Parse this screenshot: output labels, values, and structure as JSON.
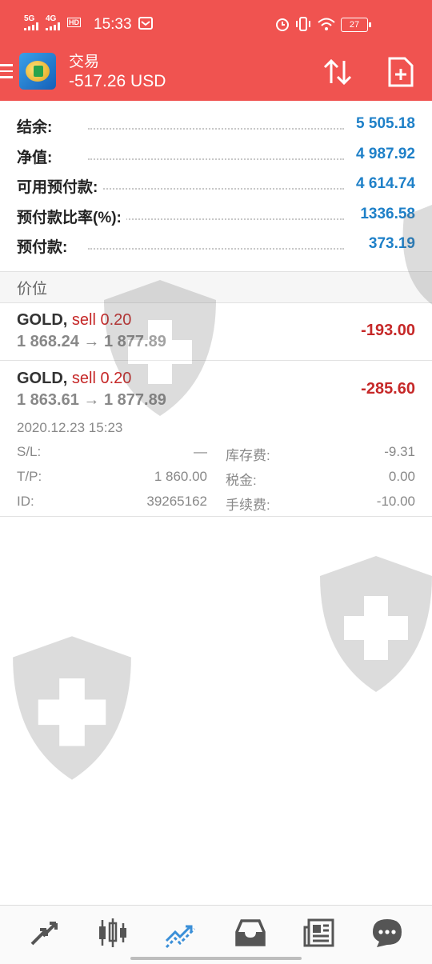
{
  "status_bar": {
    "signal1": "5G",
    "signal2": "4G",
    "hd_label": "HD",
    "time": "15:33",
    "battery": "27"
  },
  "header": {
    "title": "交易",
    "balance": "-517.26 USD"
  },
  "summary": [
    {
      "label": "结余:",
      "value": "5 505.18"
    },
    {
      "label": "净值:",
      "value": "4 987.92"
    },
    {
      "label": "可用预付款:",
      "value": "4 614.74"
    },
    {
      "label": "预付款比率(%):",
      "value": "1336.58"
    },
    {
      "label": "预付款:",
      "value": "373.19"
    }
  ],
  "section_title": "价位",
  "positions": [
    {
      "symbol": "GOLD,",
      "side": "sell 0.20",
      "prices": "1 868.24 → 1 877.89",
      "profit": "-193.00"
    },
    {
      "symbol": "GOLD,",
      "side": "sell 0.20",
      "prices": "1 863.61 → 1 877.89",
      "profit": "-285.60",
      "details": {
        "time": "2020.12.23 15:23",
        "sl_label": "S/L:",
        "sl_value": "—",
        "tp_label": "T/P:",
        "tp_value": "1 860.00",
        "id_label": "ID:",
        "id_value": "39265162",
        "swap_label": "库存费:",
        "swap_value": "-9.31",
        "tax_label": "税金:",
        "tax_value": "0.00",
        "fee_label": "手续费:",
        "fee_value": "-10.00"
      }
    }
  ],
  "bottom_nav": [
    {
      "icon": "quotes-icon"
    },
    {
      "icon": "chart-icon"
    },
    {
      "icon": "trade-icon",
      "active": true
    },
    {
      "icon": "history-icon"
    },
    {
      "icon": "news-icon"
    },
    {
      "icon": "messages-icon"
    }
  ],
  "colors": {
    "header": "#f05350",
    "positive_value": "#1e80c8",
    "loss": "#c62828",
    "active_nav": "#3a8fd8"
  }
}
